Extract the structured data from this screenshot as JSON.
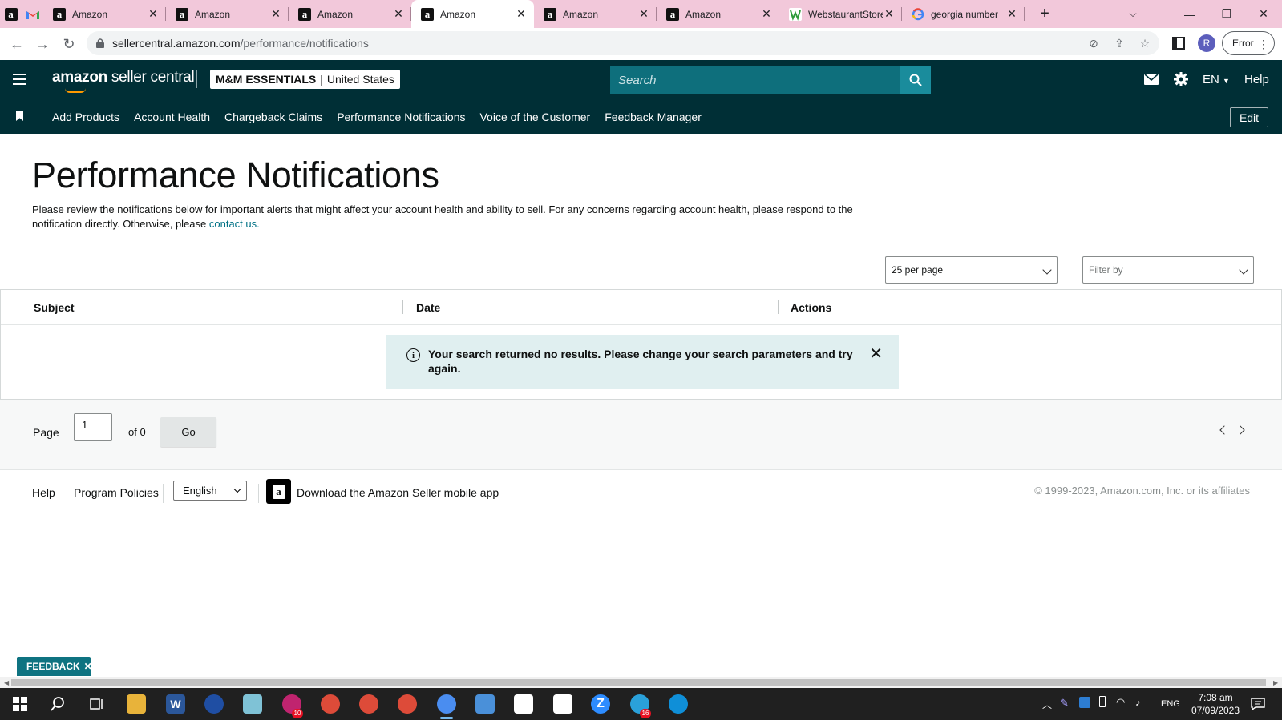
{
  "browser": {
    "tabs": [
      {
        "title": "Amazon",
        "icon": "amazon-icon"
      },
      {
        "title": "Amazon",
        "icon": "amazon-icon"
      },
      {
        "title": "Amazon",
        "icon": "amazon-icon"
      },
      {
        "title": "Amazon",
        "icon": "amazon-icon",
        "active": true
      },
      {
        "title": "Amazon",
        "icon": "amazon-icon"
      },
      {
        "title": "Amazon",
        "icon": "amazon-icon"
      },
      {
        "title": "WebstaurantStore",
        "icon": "webstaurant-icon"
      },
      {
        "title": "georgia number",
        "icon": "google-icon"
      }
    ],
    "url_host": "sellercentral.amazon.com",
    "url_path": "/performance/notifications",
    "avatar_letter": "R",
    "error_label": "Error"
  },
  "header": {
    "logo_amazon": "amazon",
    "logo_rest": " seller central",
    "store_name": "M&M ESSENTIALS",
    "store_sep": "|",
    "marketplace": "United States",
    "search_placeholder": "Search",
    "language": "EN",
    "help": "Help"
  },
  "nav": {
    "links": [
      "Add Products",
      "Account Health",
      "Chargeback Claims",
      "Performance Notifications",
      "Voice of the Customer",
      "Feedback Manager"
    ],
    "edit": "Edit"
  },
  "main": {
    "title": "Performance Notifications",
    "description": "Please review the notifications below for important alerts that might affect your account health and ability to sell. For any concerns regarding account health, please respond to the notification directly. Otherwise, please ",
    "contact_link": "contact us.",
    "per_page": "25 per page",
    "filter_placeholder": "Filter by",
    "columns": [
      "Subject",
      "Date",
      "Actions"
    ],
    "alert": "Your search returned no results. Please change your search parameters and try again.",
    "pager": {
      "label": "Page",
      "current": "1",
      "of": "of 0",
      "go": "Go"
    }
  },
  "footer": {
    "help": "Help",
    "program_policies": "Program Policies",
    "language": "English",
    "app_text": "Download the Amazon Seller mobile app",
    "copyright": "© 1999-2023, Amazon.com, Inc. or its affiliates"
  },
  "feedback": {
    "label": "FEEDBACK"
  },
  "taskbar": {
    "language": "ENG",
    "time": "7:08 am",
    "date": "07/09/2023",
    "badges": {
      "app1": "10",
      "telegram": "16"
    }
  },
  "colors": {
    "header_bg": "#002f36",
    "tabstrip_bg": "#f2c8da",
    "alert_bg": "#e0eff0",
    "link": "#007185"
  }
}
